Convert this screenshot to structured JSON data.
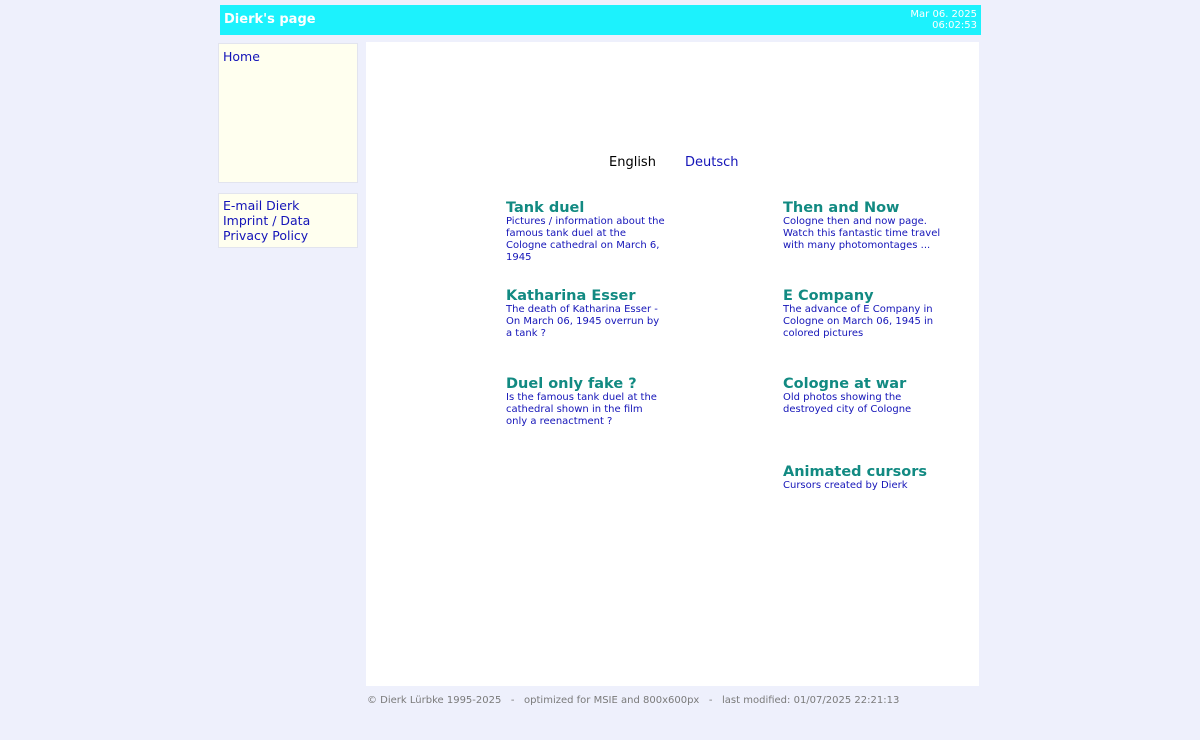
{
  "header": {
    "title": "Dierk's page",
    "date": "Mar 06. 2025",
    "time": "06:02:53",
    "bg_color": "#1cf2fd"
  },
  "nav": {
    "home": "Home"
  },
  "links": {
    "email": "E-mail Dierk",
    "imprint": "Imprint / Data",
    "privacy": "Privacy Policy"
  },
  "languages": {
    "english": "English",
    "deutsch": "Deutsch"
  },
  "entries": [
    {
      "title": "Tank duel",
      "desc": "Pictures / information about the famous tank duel at the Cologne cathedral on March 6, 1945"
    },
    {
      "title": "Then and Now",
      "desc": "Cologne then and now page. Watch this fantastic time travel with many photomontages ..."
    },
    {
      "title": "Katharina Esser",
      "desc": "The death of Katharina Esser - On March 06, 1945 overrun by a tank ?"
    },
    {
      "title": "E Company",
      "desc": "The advance of E Company in Cologne on March 06, 1945 in colored pictures"
    },
    {
      "title": "Duel only fake ?",
      "desc": "Is the famous tank duel at the cathedral shown in the film only a reenactment ?"
    },
    {
      "title": "Cologne at war",
      "desc": "Old photos showing the destroyed city of Cologne"
    },
    {
      "title": "Animated cursors",
      "desc": "Cursors created by Dierk"
    }
  ],
  "footer": {
    "text": "© Dierk Lürbke 1995-2025   -   optimized for MSIE and 800x600px   -   last modified: 01/07/2025 22:21:13"
  }
}
